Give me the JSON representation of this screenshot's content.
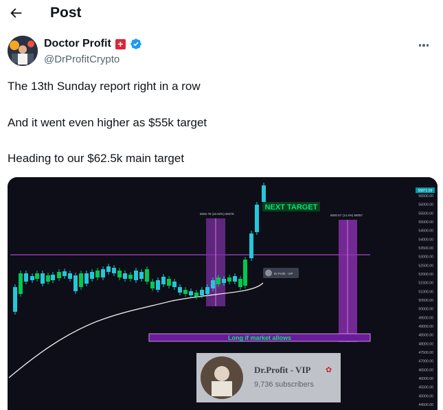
{
  "header": {
    "title": "Post",
    "back_icon": "arrow-left-icon"
  },
  "author": {
    "display_name": "Doctor Profit",
    "handle": "@DrProfitCrypto",
    "badges": [
      "red-plus-icon",
      "verified-icon"
    ],
    "verified_color": "#1d9bf0",
    "more_icon": "more-horizontal-icon"
  },
  "post": {
    "lines": [
      "The 13th Sunday report right in a row",
      "And it went even higher as $55k target",
      "Heading to our $62.5k main target"
    ]
  },
  "chart_image": {
    "labels": {
      "next_target": "NEXT TARGET",
      "long_zone": "Long if market allows",
      "zone1_note": "5026.76 (10.02%) 50378",
      "zone2_note": "6830.57 (14.4%) 68057",
      "price_current": "55871.59",
      "indicator_label": "Dr.Profit · VIP"
    },
    "watermark": {
      "name": "Dr.Profit - VIP",
      "subscribers": "9,736 subscribers"
    },
    "colors": {
      "up": "#26c6da",
      "down": "#00c853",
      "zone": "#9c27b0",
      "next": "#00e676"
    }
  },
  "chart_data": {
    "type": "candlestick",
    "title": "",
    "y_ticks": [
      "56500.00",
      "56000.00",
      "55500.00",
      "55000.00",
      "54500.00",
      "54000.00",
      "53500.00",
      "53000.00",
      "52500.00",
      "52000.00",
      "51500.00",
      "51000.00",
      "50500.00",
      "50000.00",
      "49500.00",
      "49000.00",
      "48500.00",
      "48000.00",
      "47500.00",
      "47000.00",
      "46500.00",
      "46000.00",
      "45500.00",
      "45000.00",
      "44500.00"
    ],
    "ylim": [
      44500,
      57000
    ],
    "resistance": 53000,
    "long_zone": [
      48000,
      48400
    ],
    "next_target": 55300
  }
}
